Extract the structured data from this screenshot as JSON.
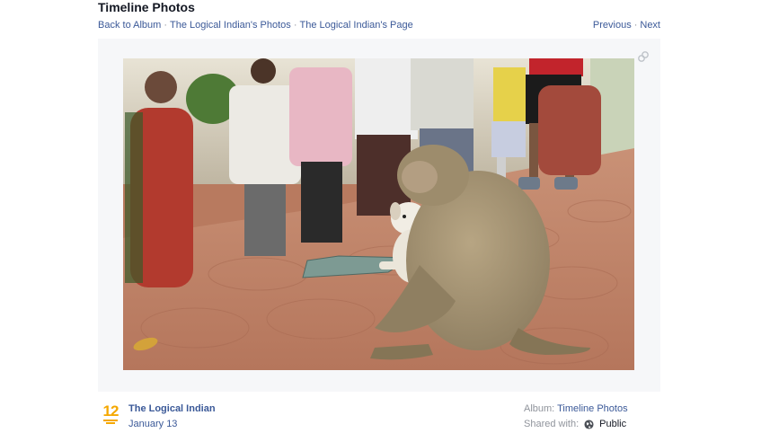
{
  "header": {
    "title": "Timeline Photos"
  },
  "breadcrumbs": {
    "back_to_album": "Back to Album",
    "sep1": "·",
    "owner_photos": "The Logical Indian's Photos",
    "sep2": "·",
    "owner_page": "The Logical Indian's Page"
  },
  "pager": {
    "previous": "Previous",
    "sep": "·",
    "next": "Next"
  },
  "photo": {
    "description_icon": "monkey-hugging-puppy-photo"
  },
  "footer": {
    "page_logo_text": "12",
    "page_name": "The Logical Indian",
    "date": "January 13",
    "album_label": "Album:",
    "album_name": "Timeline Photos",
    "shared_label": "Shared with:",
    "audience_icon": "globe-icon",
    "audience": "Public"
  },
  "colors": {
    "link": "#3b5998",
    "muted": "#90949c",
    "stage_bg": "#f6f7f9",
    "logo": "#f5a800"
  }
}
